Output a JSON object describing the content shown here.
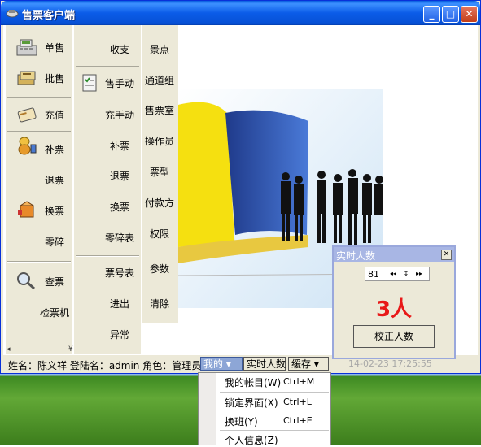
{
  "window": {
    "title": "售票客户端"
  },
  "titlebar_buttons": {
    "minimize": "_",
    "maximize": "□",
    "close": "✕"
  },
  "nav_col1": [
    {
      "label": "单售",
      "icon": "cash-register-icon"
    },
    {
      "label": "批售",
      "icon": "ticket-stack-icon"
    },
    {
      "label": "充值",
      "icon": "recharge-card-icon"
    },
    {
      "label": "补票",
      "icon": "coins-icon"
    },
    {
      "label": "退票",
      "icon": ""
    },
    {
      "label": "换票",
      "icon": "exchange-box-icon"
    },
    {
      "label": "零碎",
      "icon": ""
    },
    {
      "label": "查票",
      "icon": "magnifier-icon"
    },
    {
      "label": "检票机",
      "icon": ""
    }
  ],
  "nav_col2": [
    {
      "label": "收支"
    },
    {
      "label": "售手动",
      "icon": "checklist-icon"
    },
    {
      "label": "充手动"
    },
    {
      "label": "补票"
    },
    {
      "label": "退票"
    },
    {
      "label": "换票"
    },
    {
      "label": "零碎表"
    },
    {
      "label": "票号表"
    },
    {
      "label": "进出"
    },
    {
      "label": "异常"
    }
  ],
  "nav_col3": [
    {
      "label": "景点"
    },
    {
      "label": "通道组"
    },
    {
      "label": "售票室"
    },
    {
      "label": "操作员"
    },
    {
      "label": "票型"
    },
    {
      "label": "付款方"
    },
    {
      "label": "权限"
    },
    {
      "label": "参数"
    },
    {
      "label": "清除"
    }
  ],
  "status": {
    "info": "姓名：陈义祥 登陆名：admin 角色：管理员：",
    "mine_button": "我的 ▾",
    "realtime_button": "实时人数",
    "cache_button": "缓存 ▾",
    "datetime": "14-02-23 17:25:55"
  },
  "realtime_popup": {
    "title": "实时人数",
    "close": "✕",
    "interval_value": "81",
    "count_text": "3人",
    "fix_button": "校正人数"
  },
  "context_menu": {
    "items": [
      {
        "label": "我的帐目(W)",
        "shortcut": "Ctrl+M"
      },
      {
        "label": "锁定界面(X)",
        "shortcut": "Ctrl+L"
      },
      {
        "label": "换班(Y)",
        "shortcut": "Ctrl+E"
      },
      {
        "label": "个人信息(Z)",
        "shortcut": ""
      }
    ]
  },
  "colors": {
    "accent_red": "#e81818",
    "title_blue": "#0b5ce8",
    "panel": "#ece9d8"
  }
}
